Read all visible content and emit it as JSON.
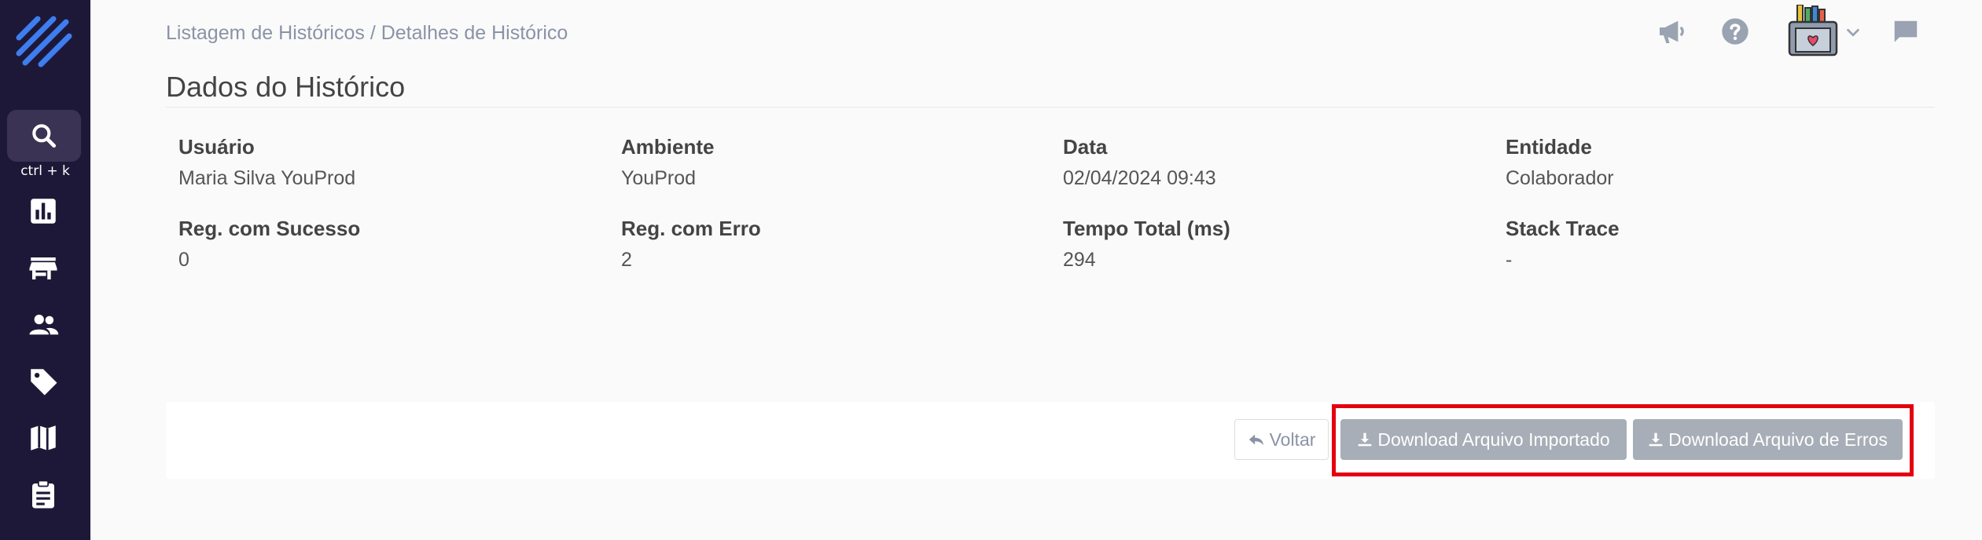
{
  "sidebar": {
    "shortcut": "ctrl + k",
    "items": [
      "search-icon",
      "chart-icon",
      "store-icon",
      "people-icon",
      "tag-icon",
      "map-icon",
      "clipboard-icon"
    ]
  },
  "header": {
    "breadcrumb": "Listagem de Históricos / Detalhes de Histórico"
  },
  "main": {
    "title": "Dados do Histórico",
    "fields": [
      {
        "label": "Usuário",
        "value": "Maria Silva YouProd"
      },
      {
        "label": "Ambiente",
        "value": "YouProd"
      },
      {
        "label": "Data",
        "value": "02/04/2024 09:43"
      },
      {
        "label": "Entidade",
        "value": "Colaborador"
      },
      {
        "label": "Reg. com Sucesso",
        "value": "0"
      },
      {
        "label": "Reg. com Erro",
        "value": "2"
      },
      {
        "label": "Tempo Total (ms)",
        "value": "294"
      },
      {
        "label": "Stack Trace",
        "value": "-"
      }
    ]
  },
  "actions": {
    "back": "Voltar",
    "download_imported": "Download Arquivo Importado",
    "download_errors": "Download Arquivo de Erros"
  },
  "colors": {
    "sidebar": "#1e1838",
    "highlight": "#e4000f",
    "button": "#a7aeb7"
  }
}
